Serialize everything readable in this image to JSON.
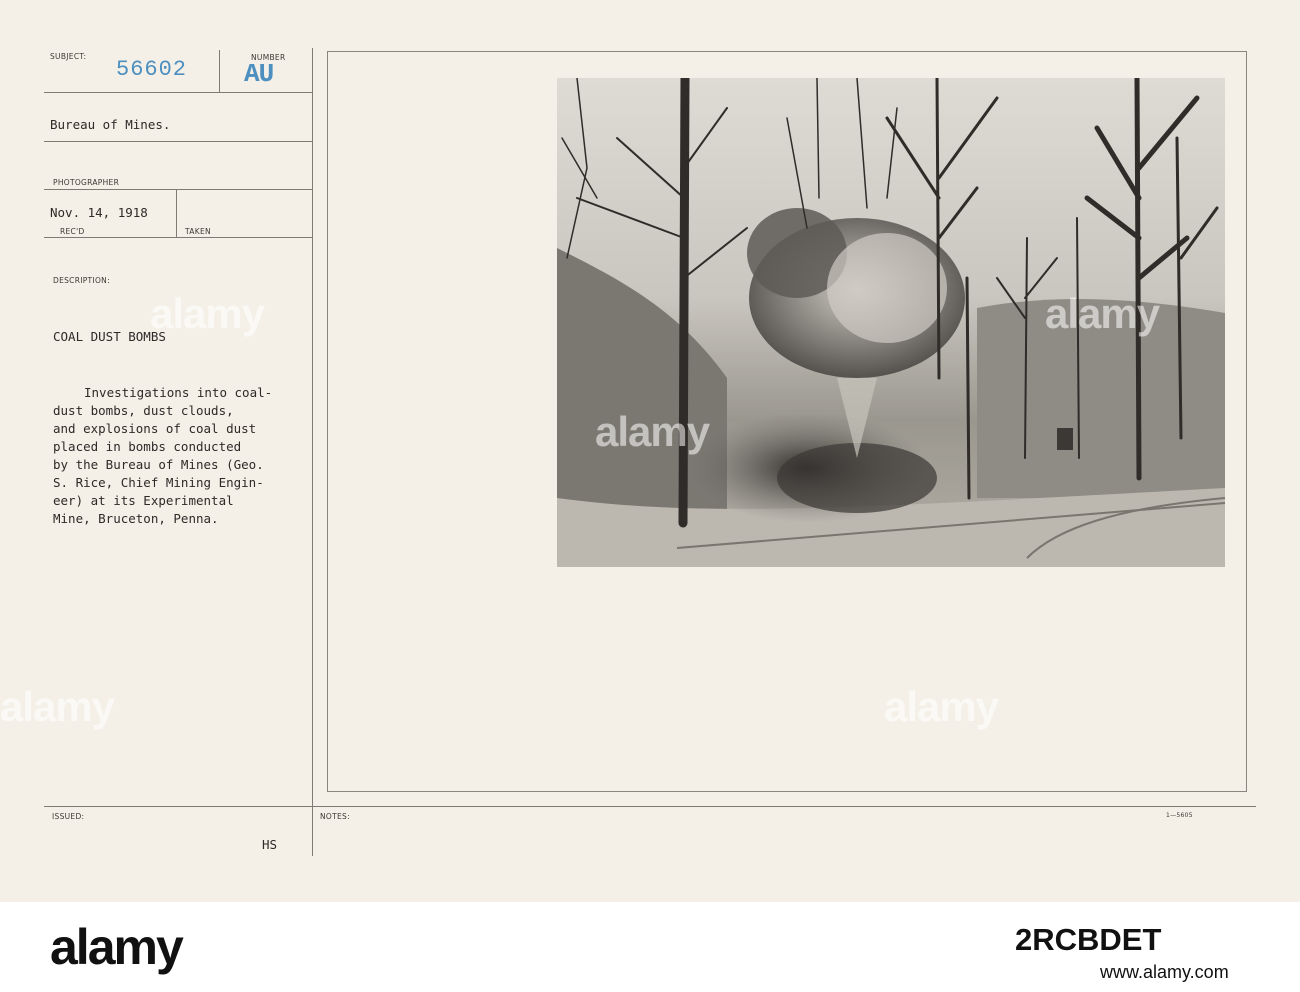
{
  "labels": {
    "subject": "SUBJECT:",
    "number": "NUMBER",
    "photographer": "PHOTOGRAPHER",
    "recd": "REC'D",
    "taken": "TAKEN",
    "description": "DESCRIPTION:",
    "issued": "ISSUED:",
    "notes": "NOTES:"
  },
  "record": {
    "number": "56602",
    "series": "AU",
    "subject": "Bureau of Mines.",
    "date_received": "Nov. 14, 1918",
    "title": "COAL DUST BOMBS",
    "description_lines": [
      "Investigations into coal-",
      "dust bombs, dust clouds,",
      "and explosions of coal dust",
      "placed in bombs conducted",
      "by the Bureau of Mines (Geo.",
      "S. Rice, Chief Mining Engin-",
      "eer) at its Experimental",
      "Mine, Bruceton, Penna."
    ],
    "issued_initials": "HS",
    "form_code": "1—5605"
  },
  "watermark": {
    "text": "alamy"
  },
  "footer": {
    "logo": "alamy",
    "image_id": "2RCBDET",
    "url": "www.alamy.com"
  },
  "colors": {
    "stamp_blue": "#4d8fbf",
    "card": "#f4f0e8",
    "footer": "#ffffff"
  }
}
